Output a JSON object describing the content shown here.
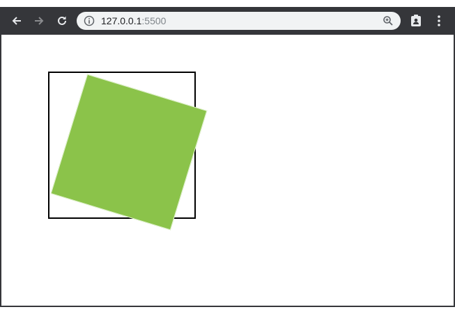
{
  "browser": {
    "url_host": "127.0.0.1",
    "url_port": ":5500",
    "icons": {
      "back": "arrow-left-icon",
      "forward": "arrow-right-icon",
      "reload": "reload-icon",
      "site_info": "info-icon",
      "zoom": "zoom-in-icon",
      "profile": "profile-icon",
      "menu": "kebab-menu-icon"
    }
  },
  "colors": {
    "toolbar": "#35363a",
    "omnibox": "#f1f3f4",
    "square_fill": "#8bc34a",
    "outline": "#000000"
  }
}
